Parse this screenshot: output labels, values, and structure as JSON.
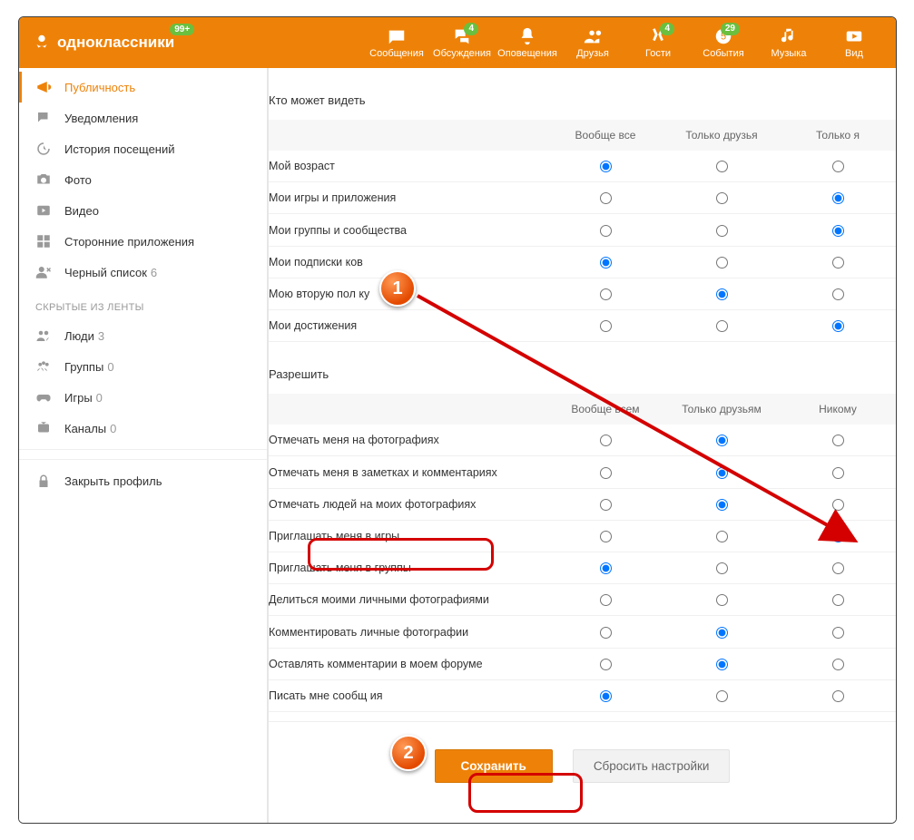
{
  "brand": "одноклассники",
  "brand_badge": "99+",
  "nav": [
    {
      "key": "messages",
      "label": "Сообщения",
      "badge": ""
    },
    {
      "key": "discussions",
      "label": "Обсуждения",
      "badge": "4"
    },
    {
      "key": "notifications",
      "label": "Оповещения",
      "badge": ""
    },
    {
      "key": "friends",
      "label": "Друзья",
      "badge": ""
    },
    {
      "key": "guests",
      "label": "Гости",
      "badge": "4"
    },
    {
      "key": "events",
      "label": "События",
      "badge": "29"
    },
    {
      "key": "music",
      "label": "Музыка",
      "badge": ""
    },
    {
      "key": "video",
      "label": "Вид",
      "badge": ""
    }
  ],
  "sidebar": {
    "items": [
      {
        "key": "publicity",
        "label": "Публичность",
        "count": "",
        "active": true
      },
      {
        "key": "notifications",
        "label": "Уведомления",
        "count": ""
      },
      {
        "key": "history",
        "label": "История посещений",
        "count": ""
      },
      {
        "key": "photo",
        "label": "Фото",
        "count": ""
      },
      {
        "key": "video",
        "label": "Видео",
        "count": ""
      },
      {
        "key": "apps",
        "label": "Сторонние приложения",
        "count": ""
      },
      {
        "key": "blacklist",
        "label": "Черный список",
        "count": "6"
      }
    ],
    "heading": "СКРЫТЫЕ ИЗ ЛЕНТЫ",
    "hidden": [
      {
        "key": "people",
        "label": "Люди",
        "count": "3"
      },
      {
        "key": "groups",
        "label": "Группы",
        "count": "0"
      },
      {
        "key": "games",
        "label": "Игры",
        "count": "0"
      },
      {
        "key": "channels",
        "label": "Каналы",
        "count": "0"
      }
    ],
    "lock": "Закрыть профиль"
  },
  "section_who": {
    "title": "Кто может видеть",
    "cols": [
      "Вообще все",
      "Только друзья",
      "Только я"
    ],
    "rows": [
      {
        "label": "Мой возраст",
        "sel": 0
      },
      {
        "label": "Мои игры и приложения",
        "sel": 2
      },
      {
        "label": "Мои группы и сообщества",
        "sel": 2
      },
      {
        "label": "Мои подписки              ков",
        "sel": 0
      },
      {
        "label": "Мою вторую пол             ку",
        "sel": 1
      },
      {
        "label": "Мои достижения",
        "sel": 2
      }
    ]
  },
  "section_allow": {
    "title": "Разрешить",
    "cols": [
      "Вообще всем",
      "Только друзьям",
      "Никому"
    ],
    "rows": [
      {
        "label": "Отмечать меня на фотографиях",
        "sel": 1
      },
      {
        "label": "Отмечать меня в заметках и комментариях",
        "sel": 1
      },
      {
        "label": "Отмечать людей на моих фотографиях",
        "sel": 1
      },
      {
        "label": "Приглашать меня в игры",
        "sel": 2
      },
      {
        "label": "Приглашать меня в группы",
        "sel": 0
      },
      {
        "label": "Делиться моими личными фотографиями",
        "sel": -1
      },
      {
        "label": "Комментировать личные фотографии",
        "sel": 1
      },
      {
        "label": "Оставлять комментарии в моем форуме",
        "sel": 1
      },
      {
        "label": "Писать мне сообщ      ия",
        "sel": 0
      }
    ]
  },
  "buttons": {
    "save": "Сохранить",
    "reset": "Сбросить настройки"
  },
  "annotations": {
    "one": "1",
    "two": "2"
  }
}
